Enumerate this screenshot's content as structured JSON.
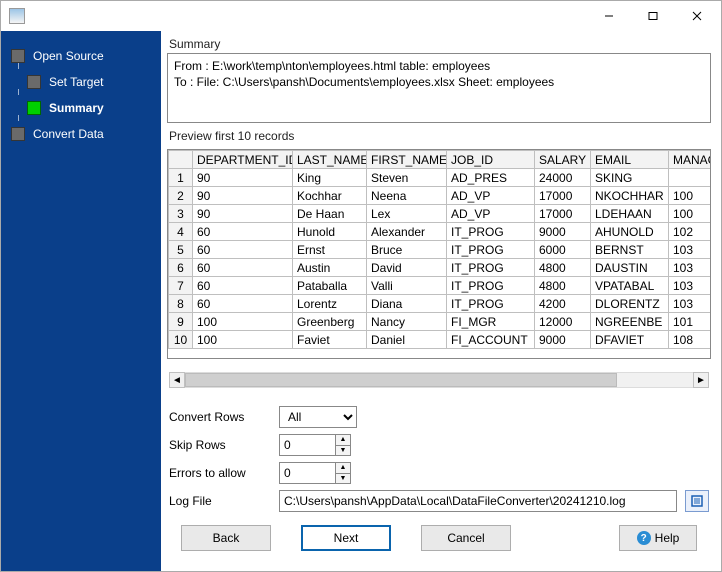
{
  "window": {
    "min_btn": "minimize",
    "max_btn": "maximize",
    "close_btn": "close"
  },
  "sidebar": {
    "items": [
      {
        "label": "Open Source",
        "active": false
      },
      {
        "label": "Set Target",
        "active": false
      },
      {
        "label": "Summary",
        "active": true
      },
      {
        "label": "Convert Data",
        "active": false
      }
    ]
  },
  "summary": {
    "label": "Summary",
    "from": "From : E:\\work\\temp\\nton\\employees.html table: employees",
    "to": "To : File: C:\\Users\\pansh\\Documents\\employees.xlsx Sheet: employees"
  },
  "preview": {
    "label": "Preview first 10 records",
    "columns": [
      "DEPARTMENT_ID",
      "LAST_NAME",
      "FIRST_NAME",
      "JOB_ID",
      "SALARY",
      "EMAIL",
      "MANAG"
    ],
    "rows": [
      [
        "90",
        "King",
        "Steven",
        "AD_PRES",
        "24000",
        "SKING",
        ""
      ],
      [
        "90",
        "Kochhar",
        "Neena",
        "AD_VP",
        "17000",
        "NKOCHHAR",
        "100"
      ],
      [
        "90",
        "De Haan",
        "Lex",
        "AD_VP",
        "17000",
        "LDEHAAN",
        "100"
      ],
      [
        "60",
        "Hunold",
        "Alexander",
        "IT_PROG",
        "9000",
        "AHUNOLD",
        "102"
      ],
      [
        "60",
        "Ernst",
        "Bruce",
        "IT_PROG",
        "6000",
        "BERNST",
        "103"
      ],
      [
        "60",
        "Austin",
        "David",
        "IT_PROG",
        "4800",
        "DAUSTIN",
        "103"
      ],
      [
        "60",
        "Pataballa",
        "Valli",
        "IT_PROG",
        "4800",
        "VPATABAL",
        "103"
      ],
      [
        "60",
        "Lorentz",
        "Diana",
        "IT_PROG",
        "4200",
        "DLORENTZ",
        "103"
      ],
      [
        "100",
        "Greenberg",
        "Nancy",
        "FI_MGR",
        "12000",
        "NGREENBE",
        "101"
      ],
      [
        "100",
        "Faviet",
        "Daniel",
        "FI_ACCOUNT",
        "9000",
        "DFAVIET",
        "108"
      ]
    ]
  },
  "options": {
    "convert_rows": {
      "label": "Convert Rows",
      "value": "All"
    },
    "skip_rows": {
      "label": "Skip Rows",
      "value": "0"
    },
    "errors_allow": {
      "label": "Errors to allow",
      "value": "0"
    },
    "log_file": {
      "label": "Log File",
      "value": "C:\\Users\\pansh\\AppData\\Local\\DataFileConverter\\20241210.log"
    }
  },
  "buttons": {
    "back": "Back",
    "next": "Next",
    "cancel": "Cancel",
    "help": "Help"
  }
}
